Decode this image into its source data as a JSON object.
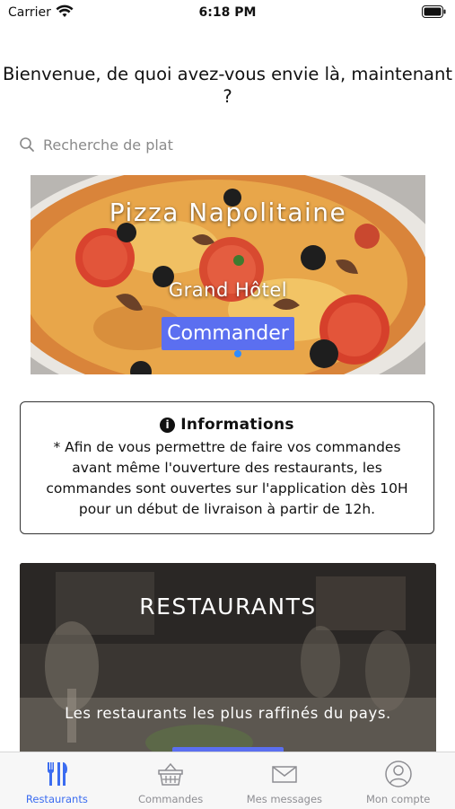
{
  "status_bar": {
    "carrier": "Carrier",
    "time": "6:18 PM"
  },
  "header": {
    "welcome": "Bienvenue, de quoi avez-vous envie là, maintenant ?"
  },
  "search": {
    "placeholder": "Recherche de plat"
  },
  "banner": {
    "title": "Pizza Napolitaine",
    "subtitle": "Grand Hôtel",
    "button_label": "Commander"
  },
  "info": {
    "title": "Informations",
    "text": "* Afin de vous permettre de faire vos commandes avant même l'ouverture des restaurants, les commandes sont ouvertes sur l'application dès 10H pour un début de livraison à partir de 12h."
  },
  "restaurants_card": {
    "title": "RESTAURANTS",
    "subtitle": "Les restaurants les plus raffinés du pays."
  },
  "tabbar": {
    "items": [
      {
        "label": "Restaurants",
        "icon": "fork-knife-icon",
        "active": true
      },
      {
        "label": "Commandes",
        "icon": "basket-icon",
        "active": false
      },
      {
        "label": "Mes messages",
        "icon": "envelope-icon",
        "active": false
      },
      {
        "label": "Mon compte",
        "icon": "user-icon",
        "active": false
      }
    ]
  },
  "colors": {
    "accent": "#5b6ff0",
    "tab_active": "#3b6cf0",
    "tab_inactive": "#8e8e93"
  }
}
